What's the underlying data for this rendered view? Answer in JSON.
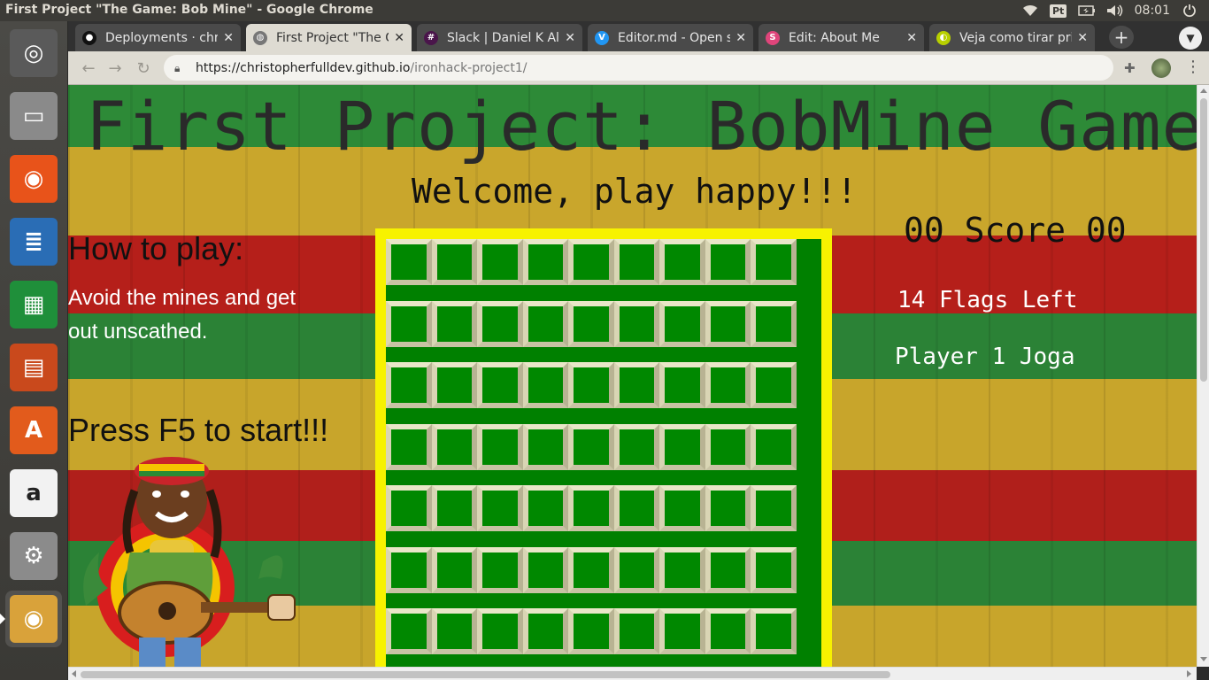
{
  "os": {
    "window_title": "First Project \"The Game: Bob Mine\" - Google Chrome",
    "keyboard_layout": "Pt",
    "clock": "08:01"
  },
  "launcher": {
    "items": [
      {
        "name": "ubuntu-dash",
        "glyph": "◎",
        "color": "#5a5a5a"
      },
      {
        "name": "files",
        "glyph": "▭",
        "color": "#8a8a8a"
      },
      {
        "name": "firefox",
        "glyph": "◉",
        "color": "#e8531a"
      },
      {
        "name": "libreoffice-writer",
        "glyph": "≣",
        "color": "#2a6db5"
      },
      {
        "name": "libreoffice-calc",
        "glyph": "▦",
        "color": "#1f8f3a"
      },
      {
        "name": "libreoffice-impress",
        "glyph": "▤",
        "color": "#c9491c"
      },
      {
        "name": "ubuntu-software",
        "glyph": "A",
        "color": "#e25b1c"
      },
      {
        "name": "amazon",
        "glyph": "a",
        "color": "#f2f2f2"
      },
      {
        "name": "system-settings",
        "glyph": "⚙",
        "color": "#8b8b8b"
      },
      {
        "name": "chrome",
        "glyph": "◉",
        "color": "#d9a23a"
      }
    ]
  },
  "tabs": [
    {
      "label": "Deployments · chri",
      "fav_color": "#111",
      "fav_glyph": "●",
      "active": false
    },
    {
      "label": "First Project \"The G",
      "fav_color": "#777",
      "fav_glyph": "◍",
      "active": true
    },
    {
      "label": "Slack | Daniel K Alb",
      "fav_color": "#4a154b",
      "fav_glyph": "#",
      "active": false
    },
    {
      "label": "Editor.md - Open s",
      "fav_color": "#2196f3",
      "fav_glyph": "V",
      "active": false
    },
    {
      "label": "Edit: About Me",
      "fav_color": "#e0457b",
      "fav_glyph": "S",
      "active": false
    },
    {
      "label": "Veja como tirar pri",
      "fav_color": "#b8d000",
      "fav_glyph": "◐",
      "active": false
    }
  ],
  "toolbar": {
    "url_host": "https://christopherfulldev.github.io",
    "url_path": "/ironhack-project1/",
    "new_tab_label": "+",
    "menu_label": "⋮"
  },
  "game": {
    "title": "First Project: BobMine Game",
    "welcome": "Welcome, play happy!!!",
    "how_to_title": "How to play:",
    "how_to_text": "Avoid the mines and get out unscathed.",
    "press_start": "Press F5 to start!!!",
    "score": "00 Score 00",
    "flags": "14 Flags Left",
    "player": "Player 1 Joga",
    "board": {
      "visible_rows": 7,
      "cols": 9,
      "cell_color": "#008800",
      "frame_color": "#f7f200"
    }
  }
}
